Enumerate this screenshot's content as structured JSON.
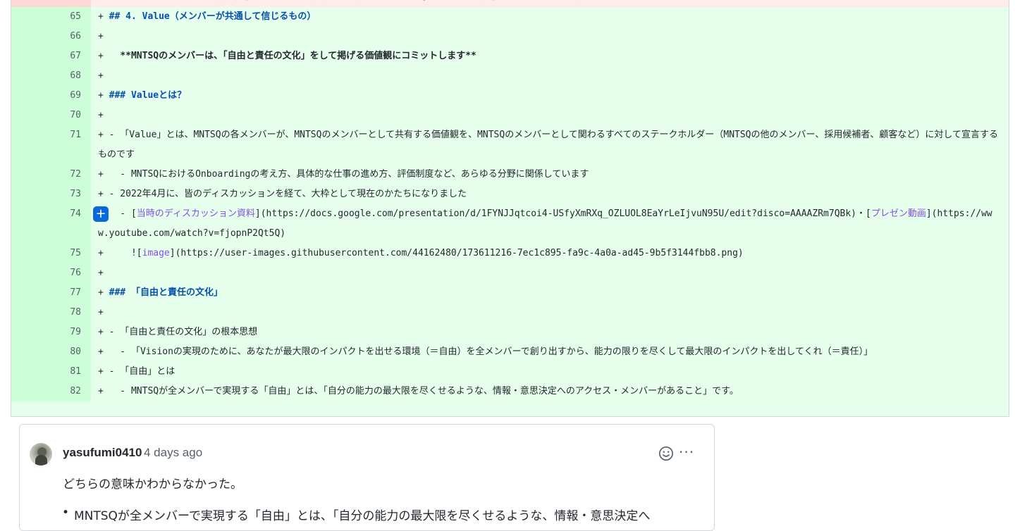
{
  "diff": {
    "removed_partial": "プロダクト全体の価値のみならず、課題発見・解決を通した法務コンテンツの価値もアップデートし続けます",
    "lines": [
      {
        "n": "65",
        "segs": [
          {
            "t": "+ ",
            "c": "mk"
          },
          {
            "t": "## 4. Value（メンバーが共通して信じるもの）",
            "c": "h"
          }
        ]
      },
      {
        "n": "66",
        "segs": [
          {
            "t": "+",
            "c": "mk"
          }
        ]
      },
      {
        "n": "67",
        "segs": [
          {
            "t": "+   ",
            "c": "mk"
          },
          {
            "t": "**MNTSQのメンバーは、「自由と責任の文化」をして掲げる価値観にコミットします**",
            "c": "b"
          }
        ]
      },
      {
        "n": "68",
        "segs": [
          {
            "t": "+",
            "c": "mk"
          }
        ]
      },
      {
        "n": "69",
        "segs": [
          {
            "t": "+ ",
            "c": "mk"
          },
          {
            "t": "### Valueとは？",
            "c": "h"
          }
        ]
      },
      {
        "n": "70",
        "segs": [
          {
            "t": "+",
            "c": "mk"
          }
        ]
      },
      {
        "n": "71",
        "segs": [
          {
            "t": "+ - 「Value」とは、MNTSQの各メンバーが、MNTSQのメンバーとして共有する価値観を、MNTSQのメンバーとして関わるすべてのステークホルダー（MNTSQの他のメンバー、採用候補者、顧客など）に対して宣言するものです",
            "c": ""
          }
        ]
      },
      {
        "n": "72",
        "segs": [
          {
            "t": "+   - MNTSQにおけるOnboardingの考え方、具体的な仕事の進め方、評価制度など、あらゆる分野に関係しています",
            "c": ""
          }
        ]
      },
      {
        "n": "73",
        "segs": [
          {
            "t": "+ - 2022年4月に、皆のディスカッションを経て、大枠として現在のかたちになりました",
            "c": ""
          }
        ]
      },
      {
        "n": "74",
        "btn": true,
        "segs": [
          {
            "t": "+   - [",
            "c": ""
          },
          {
            "t": "当時のディスカッション資料",
            "c": "link"
          },
          {
            "t": "](https://docs.google.com/presentation/d/1FYNJJqtcoi4-USfyXmRXq_OZLUOL8EaYrLeIjvuN95U/edit?disco=AAAAZRm7QBk)・[",
            "c": ""
          },
          {
            "t": "プレゼン動画",
            "c": "link"
          },
          {
            "t": "](https://www.youtube.com/watch?v=fjopnP2Qt5Q)",
            "c": ""
          }
        ]
      },
      {
        "n": "75",
        "segs": [
          {
            "t": "+     ![",
            "c": ""
          },
          {
            "t": "image",
            "c": "link"
          },
          {
            "t": "](https://user-images.githubusercontent.com/44162480/173611216-7ec1c895-fa9c-4a0a-ad45-9b5f3144fbb8.png)",
            "c": ""
          }
        ]
      },
      {
        "n": "76",
        "segs": [
          {
            "t": "+",
            "c": "mk"
          }
        ]
      },
      {
        "n": "77",
        "segs": [
          {
            "t": "+ ",
            "c": "mk"
          },
          {
            "t": "### 「自由と責任の文化」",
            "c": "h"
          }
        ]
      },
      {
        "n": "78",
        "segs": [
          {
            "t": "+",
            "c": "mk"
          }
        ]
      },
      {
        "n": "79",
        "segs": [
          {
            "t": "+ - 「自由と責任の文化」の根本思想",
            "c": ""
          }
        ]
      },
      {
        "n": "80",
        "segs": [
          {
            "t": "+   - 「Visionの実現のために、あなたが最大限のインパクトを出せる環境（＝自由）を全メンバーで創り出すから、能力の限りを尽くして最大限のインパクトを出してくれ（＝責任）」",
            "c": ""
          }
        ]
      },
      {
        "n": "81",
        "segs": [
          {
            "t": "+ - 「自由」とは",
            "c": ""
          }
        ]
      },
      {
        "n": "82",
        "segs": [
          {
            "t": "+   - MNTSQが全メンバーで実現する「自由」とは、「自分の能力の最大限を尽くせるような、情報・意思決定へのアクセス・メンバーがあること」です。",
            "c": ""
          }
        ]
      }
    ]
  },
  "comment": {
    "user": "yasufumi0410",
    "time": "4 days ago",
    "body": "どちらの意味かわからなかった。",
    "bullet": "MNTSQが全メンバーで実現する「自由」とは、「自分の能力の最大限を尽くせるような、情報・意思決定へ"
  },
  "icons": {
    "add": "plus-icon",
    "reaction": "smiley-icon",
    "more": "kebab-horizontal-icon"
  }
}
